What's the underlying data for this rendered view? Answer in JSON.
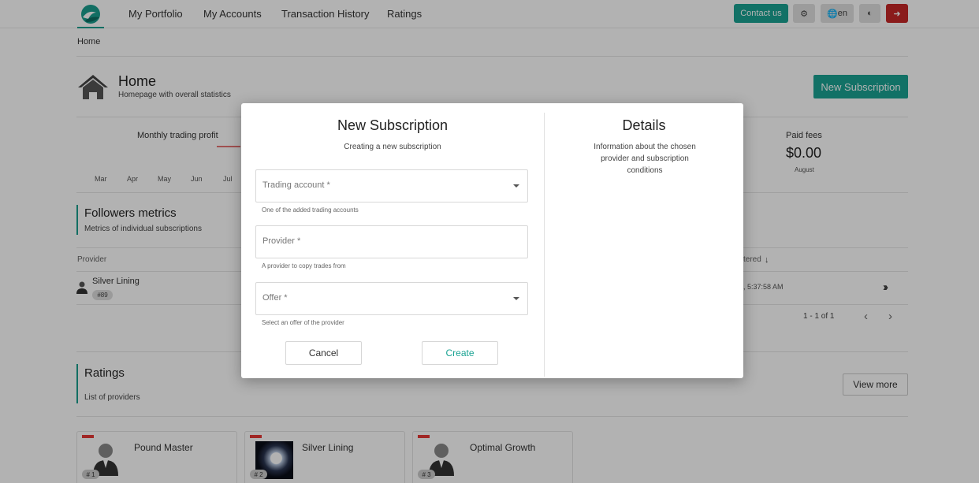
{
  "nav": {
    "items": [
      "My Portfolio",
      "My Accounts",
      "Transaction History",
      "Ratings"
    ],
    "contact": "Contact us",
    "lang": "en",
    "colors": {
      "accent": "#1aa393",
      "logout": "#c62828"
    }
  },
  "breadcrumb": "Home",
  "header": {
    "title": "Home",
    "subtitle": "Homepage with overall statistics",
    "new_subscription": "New Subscription"
  },
  "stats": {
    "monthly_label": "Monthly trading profit",
    "months": [
      "Mar",
      "Apr",
      "May",
      "Jun",
      "Jul"
    ],
    "paid_fees_label": "Paid fees",
    "paid_fees_value": "$0.00",
    "paid_fees_month": "August"
  },
  "followers": {
    "title": "Followers metrics",
    "subtitle": "Metrics of individual subscriptions",
    "col_provider": "Provider",
    "col_registered": "tered",
    "row": {
      "name": "Silver Lining",
      "badge": "#89",
      "time": ", 5:37:58 AM"
    },
    "pager": "1 - 1 of 1"
  },
  "ratings": {
    "title": "Ratings",
    "subtitle": "List of providers",
    "view_more": "View more",
    "cards": [
      {
        "name": "Pound Master",
        "rank": "# 1"
      },
      {
        "name": "Silver Lining",
        "rank": "# 2"
      },
      {
        "name": "Optimal Growth",
        "rank": "# 3"
      }
    ]
  },
  "modal": {
    "title": "New Subscription",
    "subtitle": "Creating a new subscription",
    "fields": [
      {
        "placeholder": "Trading account *",
        "hint": "One of the added trading accounts"
      },
      {
        "placeholder": "Provider *",
        "hint": "A provider to copy trades from"
      },
      {
        "placeholder": "Offer *",
        "hint": "Select an offer of the provider"
      }
    ],
    "cancel": "Cancel",
    "create": "Create",
    "details_title": "Details",
    "details_text": "Information about the chosen provider and subscription conditions"
  }
}
